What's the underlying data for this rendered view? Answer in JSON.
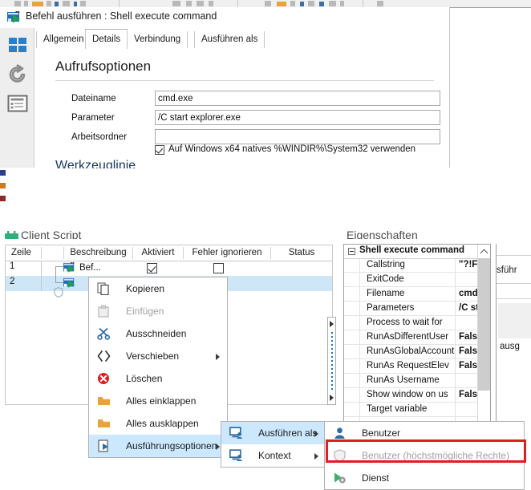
{
  "dialog": {
    "icon": "shell-execute-command-icon",
    "title": "Befehl ausführen : Shell execute command",
    "tabs": [
      {
        "label": "Allgemein",
        "active": false
      },
      {
        "label": "Details",
        "active": true
      },
      {
        "label": "Verbindung",
        "active": false
      },
      {
        "label": "Ausführen als",
        "active": false
      }
    ],
    "rail_icons": [
      "windows-grid-icon",
      "refresh-circular-arrow-icon",
      "document-lines-icon"
    ],
    "section_title": "Aufrufsoptionen",
    "fields": [
      {
        "label": "Dateiname",
        "value": "cmd.exe",
        "placeholder": ""
      },
      {
        "label": "Parameter",
        "value": "/C start explorer.exe",
        "placeholder": ""
      },
      {
        "label": "Arbeitsordner",
        "value": "",
        "placeholder": ""
      }
    ],
    "checkbox": {
      "label": "Auf Windows x64 natives %WINDIR%\\System32 verwenden",
      "checked": true
    },
    "cut_off_heading": "Werkzeuglinie"
  },
  "client_script": {
    "panel_title": "Client Script",
    "columns": [
      "Zeile",
      "",
      "Beschreibung",
      "Aktiviert",
      "Fehler ignorieren",
      "Status"
    ],
    "rows": [
      {
        "zeile": "1",
        "shield": false,
        "beschreibung": "Bef...",
        "aktiviert": true,
        "fehler_ignorieren": false,
        "status": "",
        "selected": false
      },
      {
        "zeile": "2",
        "shield": true,
        "beschreibung": "",
        "aktiviert": false,
        "fehler_ignorieren": false,
        "status": "",
        "selected": true
      }
    ]
  },
  "properties": {
    "panel_title": "Eigenschaften",
    "group": "Shell execute command",
    "items": [
      {
        "name": "Callstring",
        "value": "\"?!File"
      },
      {
        "name": "ExitCode",
        "value": ""
      },
      {
        "name": "Filename",
        "value": "cmd.e"
      },
      {
        "name": "Parameters",
        "value": "/C sta"
      },
      {
        "name": "Process to wait for",
        "value": ""
      },
      {
        "name": "RunAsDifferentUser",
        "value": "False"
      },
      {
        "name": "RunAsGlobalAccount",
        "value": "False"
      },
      {
        "name": "RunAs RequestElev",
        "value": "False"
      },
      {
        "name": "RunAs Username",
        "value": ""
      },
      {
        "name": "Show window on us",
        "value": "False"
      },
      {
        "name": "Target variable",
        "value": ""
      }
    ]
  },
  "right_fragments": {
    "line1": "sführ",
    "line2": "ausg"
  },
  "context_menu": {
    "items": [
      {
        "label": "Kopieren",
        "icon": "copy-icon",
        "disabled": false,
        "submenu": false,
        "highlighted": false
      },
      {
        "label": "Einfügen",
        "icon": "paste-icon",
        "disabled": true,
        "submenu": false,
        "highlighted": false
      },
      {
        "label": "Ausschneiden",
        "icon": "scissors-icon",
        "disabled": false,
        "submenu": false,
        "highlighted": false
      },
      {
        "label": "Verschieben",
        "icon": "move-arrows-icon",
        "disabled": false,
        "submenu": true,
        "highlighted": false
      },
      {
        "label": "Löschen",
        "icon": "delete-red-x-icon",
        "disabled": false,
        "submenu": false,
        "highlighted": false
      },
      {
        "label": "Alles einklappen",
        "icon": "folder-collapse-icon",
        "disabled": false,
        "submenu": false,
        "highlighted": false
      },
      {
        "label": "Alles ausklappen",
        "icon": "folder-expand-icon",
        "disabled": false,
        "submenu": false,
        "highlighted": false
      },
      {
        "label": "Ausführungsoptionen",
        "icon": "run-options-icon",
        "disabled": false,
        "submenu": true,
        "highlighted": true
      }
    ]
  },
  "submenu_execution": {
    "items": [
      {
        "label": "Ausführen als",
        "icon": "monitor-user-icon",
        "submenu": true,
        "highlighted": true
      },
      {
        "label": "Kontext",
        "icon": "monitor-user-icon",
        "submenu": true,
        "highlighted": false
      }
    ]
  },
  "submenu_runas": {
    "items": [
      {
        "label": "Benutzer",
        "icon": "user-icon",
        "disabled": false,
        "highlighted": false
      },
      {
        "label": "Benutzer (höchstmögliche Rechte)",
        "icon": "shield-icon",
        "disabled": true,
        "highlighted": false
      },
      {
        "label": "Dienst",
        "icon": "service-gear-icon",
        "disabled": false,
        "highlighted": false
      }
    ]
  },
  "annotation": {
    "highlight_color": "#e31b23",
    "highlight_target": "Benutzer (höchstmögliche Rechte)"
  },
  "colors": {
    "selection_blue": "#cce8ff",
    "row_selection": "#cfe6f7",
    "accent_blue": "#2e6da4",
    "red": "#e31b23"
  }
}
